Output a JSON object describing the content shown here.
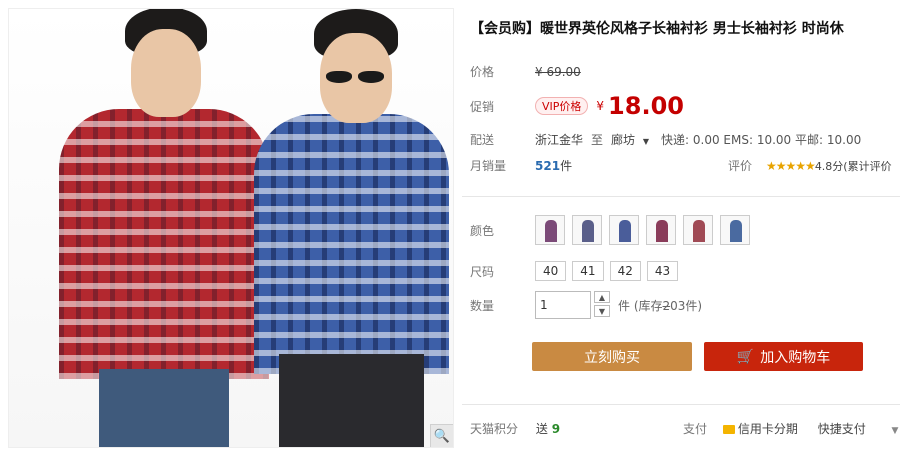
{
  "product": {
    "title": "【会员购】暖世界英伦风格子长袖衬衫 男士长袖衬衫 时尚休",
    "price_label": "价格",
    "original_price": "¥ 69.00",
    "promo_label": "促销",
    "vip_badge": "VIP价格",
    "currency": "¥",
    "promo_price": "18.00",
    "shipping_label": "配送",
    "shipping_from": "浙江金华",
    "shipping_to_word": "至",
    "shipping_to": "廊坊",
    "shipping_fees": "快递: 0.00 EMS: 10.00 平邮: 10.00",
    "sales_label": "月销量",
    "sales_count": "521",
    "sales_unit": "件",
    "rating_label": "评价",
    "rating_stars": "★★★★★",
    "rating_text": "4.8分(累计评价"
  },
  "options": {
    "color_label": "颜色",
    "colors": [
      "#7b4a78",
      "#5a5f8a",
      "#4a5d9a",
      "#8a3c5a",
      "#a04a55",
      "#4a6aa0"
    ],
    "size_label": "尺码",
    "sizes": [
      "40",
      "41",
      "42",
      "43"
    ],
    "quantity_label": "数量",
    "quantity_value": "1",
    "stock_text": "件 (库存2̶03件)"
  },
  "actions": {
    "buy_now": "立刻购买",
    "add_to_cart": "加入购物车"
  },
  "footer": {
    "points_label": "天猫积分",
    "points_prefix": "送",
    "points_value": "9",
    "pay_label": "支付",
    "credit_installment": "信用卡分期",
    "express_pay": "快捷支付"
  },
  "icons": {
    "zoom": "magnifier-icon",
    "cart": "cart-icon",
    "dropdown": "caret-down-icon"
  }
}
